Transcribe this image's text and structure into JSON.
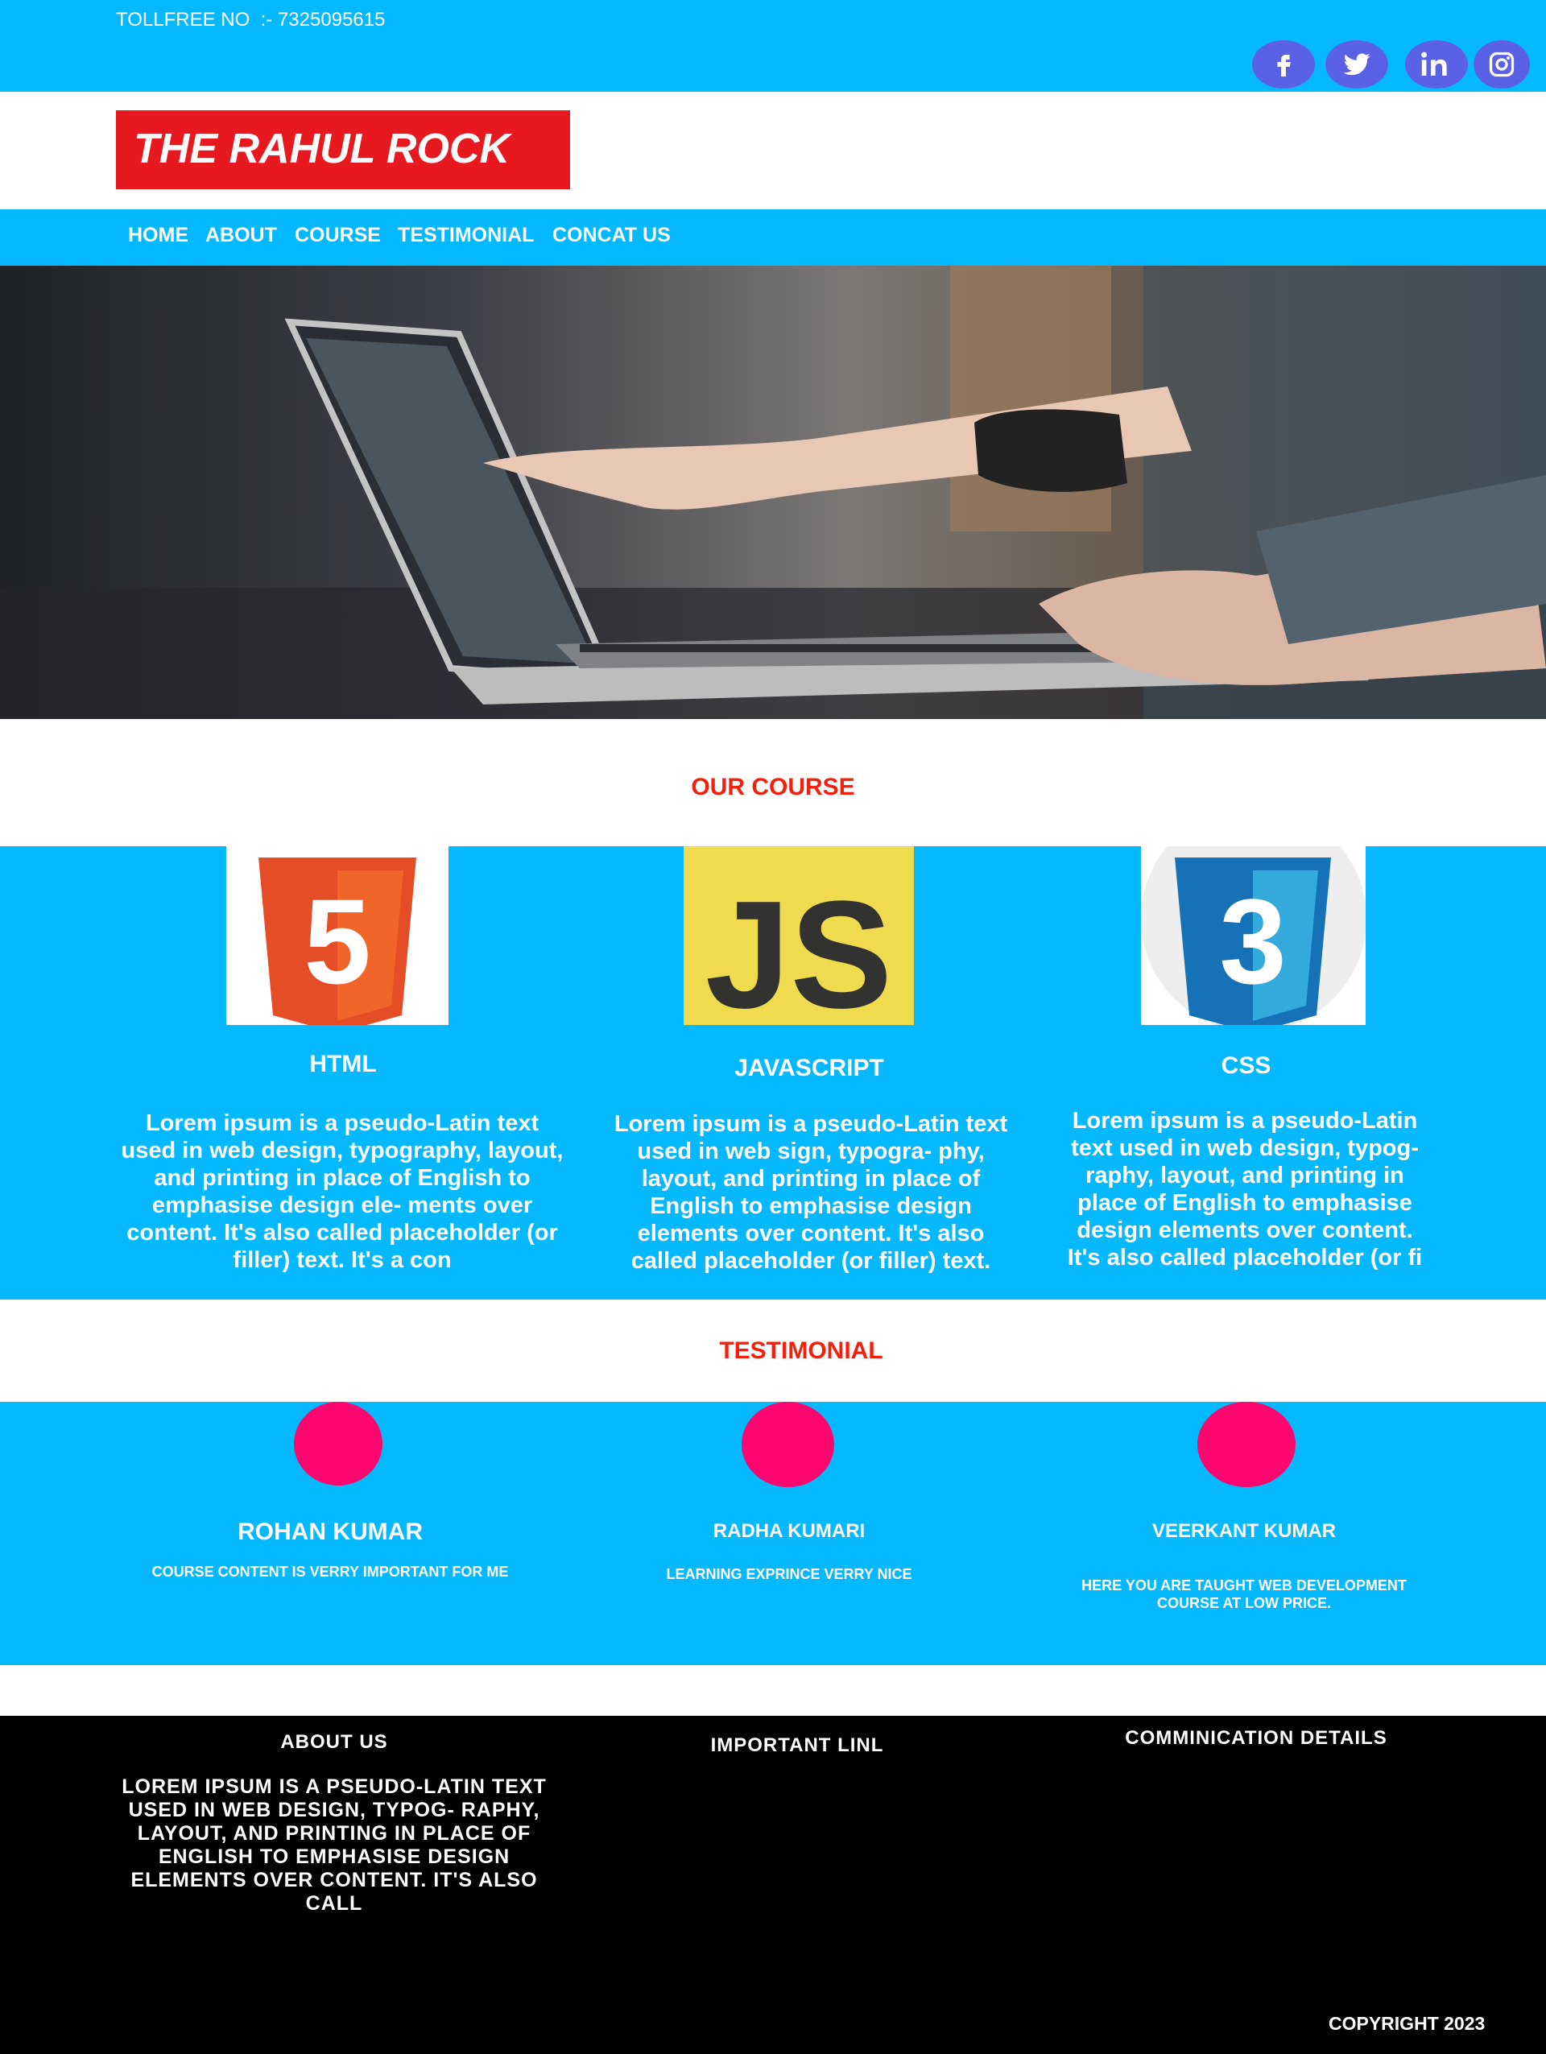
{
  "topbar": {
    "tollfree": "TOLLFREE NO  :- 7325095615",
    "social_icons": [
      "facebook-icon",
      "twitter-icon",
      "linkedin-icon",
      "instagram-icon"
    ],
    "color": "#06b8fd"
  },
  "brand": {
    "logo_text": "THE RAHUL ROCK",
    "color": "#e8191e"
  },
  "nav": {
    "items": [
      "HOME",
      "ABOUT",
      "COURSE",
      "TESTIMONIAL",
      "CONCAT US"
    ]
  },
  "courses": {
    "title": "OUR COURSE",
    "items": [
      {
        "name": "HTML",
        "logo_text": "5",
        "text": "Lorem ipsum is a pseudo-Latin text used in web design, typography, layout, and printing in place of English to emphasise design ele- ments over content. It's also called placeholder (or filler) text. It's a con"
      },
      {
        "name": "JAVASCRIPT",
        "logo_text": "JS",
        "text": "Lorem ipsum is a pseudo-Latin text used in web sign, typogra- phy, layout, and printing in place of English to emphasise design elements over content. It's also called placeholder (or filler) text."
      },
      {
        "name": "CSS",
        "logo_text": "3",
        "text": "Lorem ipsum is a pseudo-Latin text used in web design, typog- raphy, layout, and printing in place of English to emphasise design elements over content. It's also called placeholder (or fi"
      }
    ]
  },
  "testimonials": {
    "title": "TESTIMONIAL",
    "items": [
      {
        "name": "ROHAN KUMAR",
        "quote": "COURSE CONTENT IS VERRY IMPORTANT FOR ME"
      },
      {
        "name": "RADHA KUMARI",
        "quote": "LEARNING EXPRINCE VERRY NICE"
      },
      {
        "name": "VEERKANT KUMAR",
        "quote": "HERE YOU ARE TAUGHT WEB DEVELOPMENT COURSE AT LOW PRICE."
      }
    ],
    "avatar_color": "#fc066f"
  },
  "footer": {
    "about_title": "ABOUT US",
    "about_text": "LOREM IPSUM IS A PSEUDO-LATIN TEXT USED IN WEB DESIGN, TYPOG- RAPHY, LAYOUT, AND PRINTING IN PLACE OF ENGLISH TO EMPHASISE DESIGN ELEMENTS OVER CONTENT. IT'S ALSO CALL",
    "links_title": "IMPORTANT LINL",
    "contact_title": "COMMINICATION DETAILS",
    "copyright": "COPYRIGHT 2023"
  }
}
